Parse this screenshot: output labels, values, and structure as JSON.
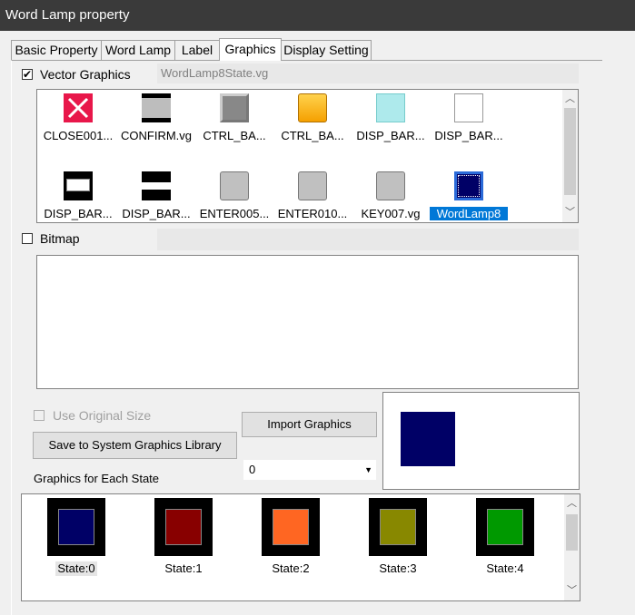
{
  "window": {
    "title": "Word Lamp property"
  },
  "tabs": [
    {
      "label": "Basic Property"
    },
    {
      "label": "Word Lamp"
    },
    {
      "label": "Label"
    },
    {
      "label": "Graphics"
    },
    {
      "label": "Display Setting"
    }
  ],
  "vector": {
    "label": "Vector Graphics",
    "checked": true,
    "file": "WordLamp8State.vg",
    "items": [
      {
        "caption": "CLOSE001...",
        "icon": "close-icon"
      },
      {
        "caption": "CONFIRM.vg",
        "icon": "confirm-icon"
      },
      {
        "caption": "CTRL_BA...",
        "icon": "ctrl-bar-icon"
      },
      {
        "caption": "CTRL_BA...",
        "icon": "ctrl-bar-orange-icon"
      },
      {
        "caption": "DISP_BAR...",
        "icon": "disp-bar-cyan-icon"
      },
      {
        "caption": "DISP_BAR...",
        "icon": "disp-bar-white-icon"
      },
      {
        "caption": "DISP_BAR...",
        "icon": "disp-bar-black-icon"
      },
      {
        "caption": "DISP_BAR...",
        "icon": "disp-bar-stripe-icon"
      },
      {
        "caption": "ENTER005...",
        "icon": "enter-icon"
      },
      {
        "caption": "ENTER010...",
        "icon": "enter-icon"
      },
      {
        "caption": "KEY007.vg",
        "icon": "key-icon"
      },
      {
        "caption": "WordLamp8",
        "icon": "word-lamp-icon"
      }
    ]
  },
  "bitmap": {
    "label": "Bitmap",
    "checked": false
  },
  "use_original_size": {
    "label": "Use Original Size"
  },
  "buttons": {
    "save": "Save to System Graphics Library",
    "import": "Import Graphics"
  },
  "state_select": {
    "value": "0"
  },
  "states_section": {
    "label": "Graphics for Each State"
  },
  "states": [
    {
      "caption": "State:0",
      "color": "#000066"
    },
    {
      "caption": "State:1",
      "color": "#880000"
    },
    {
      "caption": "State:2",
      "color": "#ff6622"
    },
    {
      "caption": "State:3",
      "color": "#888800"
    },
    {
      "caption": "State:4",
      "color": "#009900"
    }
  ],
  "preview": {
    "color": "#000066"
  }
}
